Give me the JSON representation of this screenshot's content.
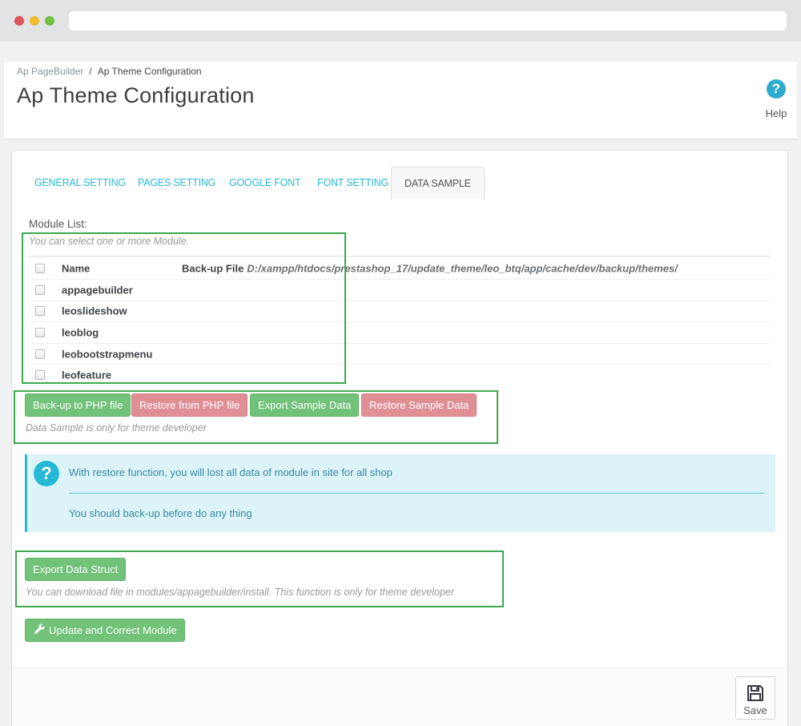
{
  "breadcrumb": {
    "parent": "Ap PageBuilder",
    "separator": "/",
    "current": "Ap Theme Configuration"
  },
  "page_title": "Ap Theme Configuration",
  "help": {
    "icon": "?",
    "label": "Help"
  },
  "tabs": [
    {
      "label": "GENERAL SETTING",
      "active": false
    },
    {
      "label": "PAGES SETTING",
      "active": false
    },
    {
      "label": "GOOGLE FONT",
      "active": false
    },
    {
      "label": "FONT SETTING",
      "active": false
    },
    {
      "label": "DATA SAMPLE",
      "active": true
    }
  ],
  "module_list": {
    "label": "Module List:",
    "hint": "You can select one or more Module.",
    "header_name": "Name",
    "header_backup": "Back-up File",
    "backup_path": "D:/xampp/htdocs/prestashop_17/update_theme/leo_btq/app/cache/dev/backup/themes/",
    "modules": [
      "appagebuilder",
      "leoslideshow",
      "leoblog",
      "leobootstrapmenu",
      "leofeature"
    ]
  },
  "buttons": {
    "backup_php": "Back-up to PHP file",
    "restore_php": "Restore from PHP file",
    "export_sample": "Export Sample Data",
    "restore_sample": "Restore Sample Data",
    "export_struct": "Export Data Struct",
    "update_module": "Update and Correct Module",
    "save": "Save"
  },
  "data_sample_hint": "Data Sample is only for theme developer",
  "alert": {
    "icon": "?",
    "line1": "With restore function, you will lost all data of module in site for all shop",
    "line2": "You should back-up before do any thing"
  },
  "struct_hint": "You can download file in modules/appagebuilder/install. This function is only for theme developer",
  "colors": {
    "accent": "#25b9d7",
    "success": "#72c279",
    "danger": "#e08f95",
    "highlight_frame": "#3fa84d"
  },
  "icons": {
    "help": "question-circle-icon",
    "alert": "question-circle-icon",
    "update": "wrench-icon",
    "save": "floppy-disk-icon"
  }
}
